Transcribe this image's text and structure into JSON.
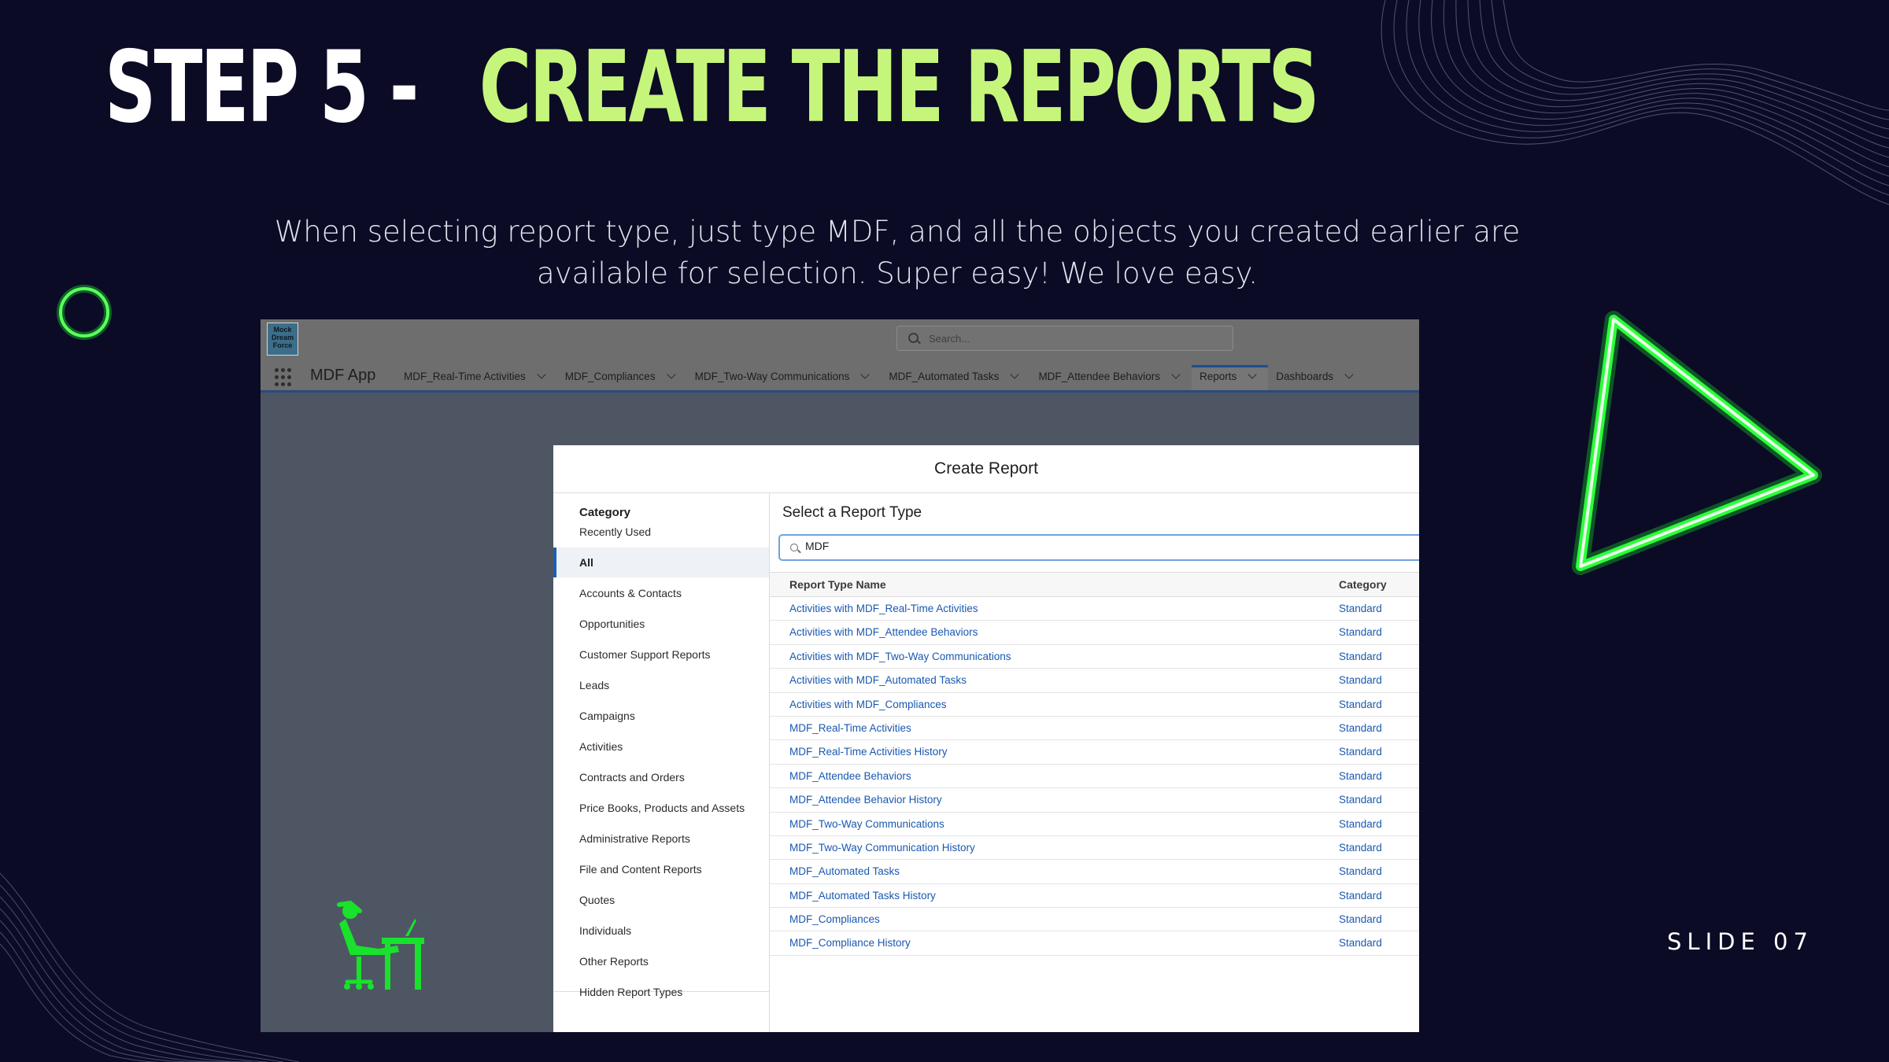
{
  "slide": {
    "title_white": "STEP 5 -",
    "title_green": "CREATE THE REPORTS",
    "subtitle": "When selecting report type, just type MDF, and all the objects you created earlier are available for selection.  Super easy!  We love easy.",
    "slide_number": "SLIDE 07"
  },
  "app": {
    "logo_text": "Mock Dream Force",
    "search_placeholder": "Search...",
    "app_name": "MDF App",
    "nav_tabs": [
      {
        "label": "MDF_Real-Time Activities"
      },
      {
        "label": "MDF_Compliances"
      },
      {
        "label": "MDF_Two-Way Communications"
      },
      {
        "label": "MDF_Automated Tasks"
      },
      {
        "label": "MDF_Attendee Behaviors"
      },
      {
        "label": "Reports",
        "active": true
      },
      {
        "label": "Dashboards"
      }
    ]
  },
  "modal": {
    "title": "Create Report",
    "category_heading": "Category",
    "categories": [
      "Recently Used",
      "All",
      "Accounts & Contacts",
      "Opportunities",
      "Customer Support Reports",
      "Leads",
      "Campaigns",
      "Activities",
      "Contracts and Orders",
      "Price Books, Products and Assets",
      "Administrative Reports",
      "File and Content Reports",
      "Quotes",
      "Individuals",
      "Other Reports",
      "Hidden Report Types"
    ],
    "selected_category": "All",
    "report_type_heading": "Select a Report Type",
    "search_value": "MDF",
    "columns": [
      "Report Type Name",
      "Category"
    ],
    "rows": [
      [
        "Activities with MDF_Real-Time Activities",
        "Standard"
      ],
      [
        "Activities with MDF_Attendee Behaviors",
        "Standard"
      ],
      [
        "Activities with MDF_Two-Way Communications",
        "Standard"
      ],
      [
        "Activities with MDF_Automated Tasks",
        "Standard"
      ],
      [
        "Activities with MDF_Compliances",
        "Standard"
      ],
      [
        "MDF_Real-Time Activities",
        "Standard"
      ],
      [
        "MDF_Real-Time Activities History",
        "Standard"
      ],
      [
        "MDF_Attendee Behaviors",
        "Standard"
      ],
      [
        "MDF_Attendee Behavior History",
        "Standard"
      ],
      [
        "MDF_Two-Way Communications",
        "Standard"
      ],
      [
        "MDF_Two-Way Communication History",
        "Standard"
      ],
      [
        "MDF_Automated Tasks",
        "Standard"
      ],
      [
        "MDF_Automated Tasks History",
        "Standard"
      ],
      [
        "MDF_Compliances",
        "Standard"
      ],
      [
        "MDF_Compliance History",
        "Standard"
      ]
    ]
  },
  "colors": {
    "background": "#0b0b26",
    "title_accent": "#c6f57c",
    "neon_green": "#19ff2a",
    "link_blue": "#1a58b0",
    "selection_bar": "#1b5fb4"
  },
  "icons": [
    "neon-circle",
    "neon-triangle",
    "relaxing-person-at-desk-icon",
    "search-icon",
    "app-launcher-icon",
    "chevron-down-icon"
  ]
}
